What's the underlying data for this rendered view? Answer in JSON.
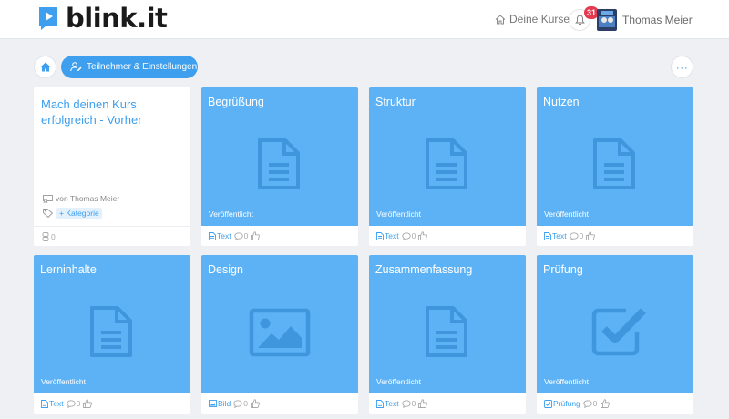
{
  "header": {
    "logo_text": "blink.it",
    "nav_courses": "Deine Kurse",
    "notification_count": "31",
    "user_name": "Thomas Meier"
  },
  "toolbar": {
    "participants_label": "Teilnehmer & Einstellungen",
    "more_label": "···"
  },
  "course": {
    "title": "Mach deinen Kurs erfolgreich - Vorher",
    "author": "von Thomas Meier",
    "category": "+ Kategorie",
    "participants": "0"
  },
  "tiles": [
    {
      "title": "Begrüßung",
      "status": "Veröffentlicht",
      "type": "Text",
      "comments": "0",
      "icon": "document-icon"
    },
    {
      "title": "Struktur",
      "status": "Veröffentlicht",
      "type": "Text",
      "comments": "0",
      "icon": "document-icon"
    },
    {
      "title": "Nutzen",
      "status": "Veröffentlicht",
      "type": "Text",
      "comments": "0",
      "icon": "document-icon"
    },
    {
      "title": "Lerninhalte",
      "status": "Veröffentlicht",
      "type": "Text",
      "comments": "0",
      "icon": "document-icon"
    },
    {
      "title": "Design",
      "status": "",
      "type": "Bild",
      "comments": "0",
      "icon": "image-icon"
    },
    {
      "title": "Zusammenfassung",
      "status": "Veröffentlicht",
      "type": "Text",
      "comments": "0",
      "icon": "document-icon"
    },
    {
      "title": "Prüfung",
      "status": "Veröffentlicht",
      "type": "Prüfung",
      "comments": "0",
      "icon": "checkbox-icon"
    }
  ],
  "colors": {
    "accent": "#3d9fee",
    "tile": "#5db2f6",
    "tile_icon": "#3f96dc",
    "badge": "#e53950",
    "background": "#eef0f3"
  }
}
